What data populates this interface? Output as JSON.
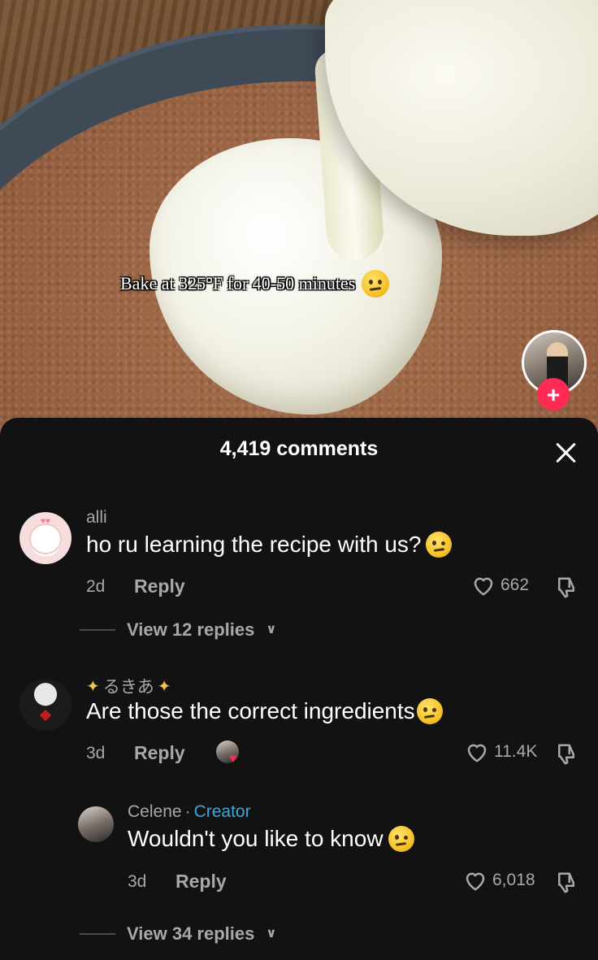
{
  "video": {
    "caption": "Bake at 325°F for 40-50 minutes",
    "follow_label": "+"
  },
  "sheet": {
    "title": "4,419 comments"
  },
  "comments": [
    {
      "username": "alli",
      "text": "ho ru learning the recipe with us?",
      "time": "2d",
      "reply_label": "Reply",
      "likes": "662",
      "view_replies": "View 12 replies"
    },
    {
      "username": "るきあ",
      "text": "Are those the correct ingredients",
      "time": "3d",
      "reply_label": "Reply",
      "likes": "11.4K",
      "view_replies": "View 34 replies",
      "reply": {
        "username": "Celene",
        "creator_tag": "Creator",
        "text": "Wouldn't you like to know",
        "time": "3d",
        "reply_label": "Reply",
        "likes": "6,018"
      }
    }
  ],
  "colors": {
    "follow": "#fe2c55",
    "creator_tag": "#3fa7d8",
    "sheet_bg": "#121212",
    "muted_text": "#a8a8a8"
  }
}
